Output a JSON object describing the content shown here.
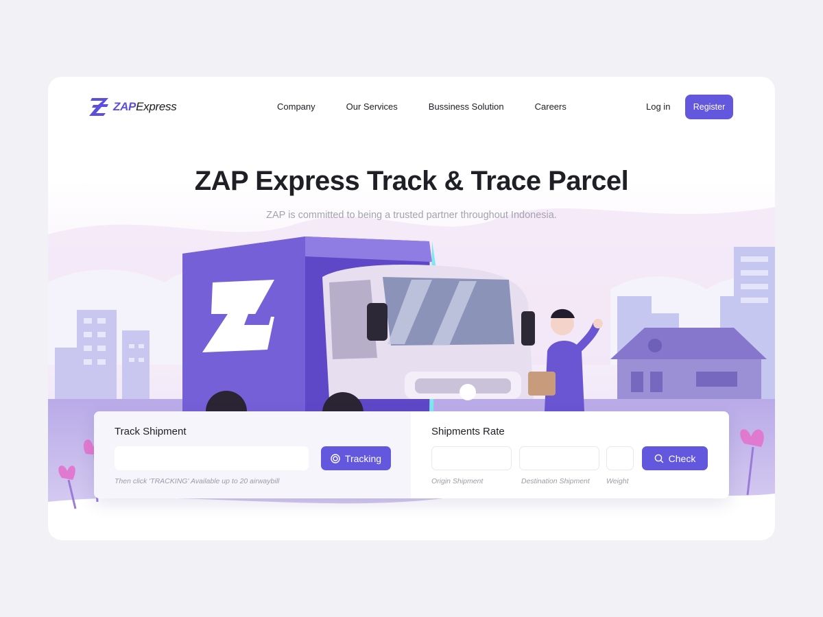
{
  "brand": {
    "name_accent": "ZAP",
    "name_rest": "Express"
  },
  "nav": {
    "items": [
      "Company",
      "Our Services",
      "Bussiness Solution",
      "Careers"
    ],
    "login": "Log in",
    "register": "Register"
  },
  "hero": {
    "title": "ZAP Express Track & Trace Parcel",
    "subtitle": "ZAP is committed to being a trusted partner throughout Indonesia."
  },
  "track": {
    "title": "Track Shipment",
    "input_value": "",
    "button": "Tracking",
    "hint": "Then click 'TRACKING' Available up to 20 airwaybill"
  },
  "rate": {
    "title": "Shipments Rate",
    "origin_label": "Origin Shipment",
    "destination_label": "Destination Shipment",
    "weight_label": "Weight",
    "button": "Check"
  },
  "colors": {
    "accent": "#6257dd",
    "background": "#f1f1f6",
    "illustration": "#7a65d6"
  },
  "icons": {
    "tracking": "target-icon",
    "check": "search-icon"
  }
}
